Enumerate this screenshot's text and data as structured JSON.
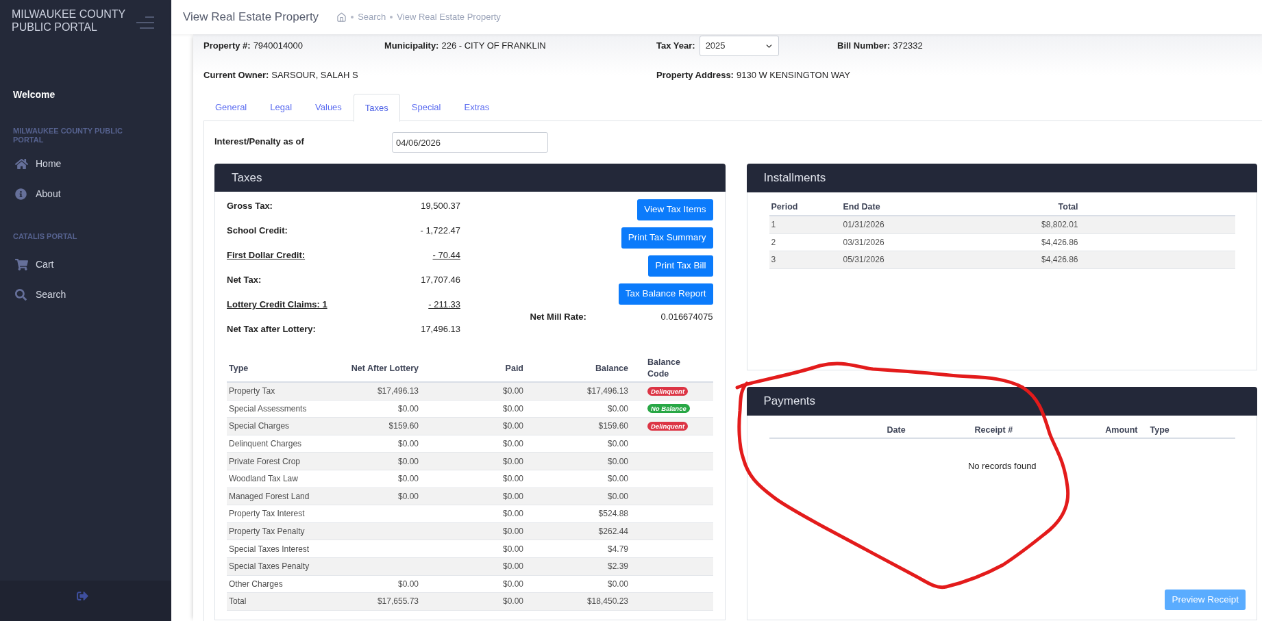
{
  "sidebar": {
    "title": "MILWAUKEE COUNTY PUBLIC PORTAL",
    "welcome": "Welcome",
    "sections": [
      {
        "heading": "MILWAUKEE COUNTY PUBLIC PORTAL",
        "items": [
          {
            "label": "Home",
            "kind": "home"
          },
          {
            "label": "About",
            "kind": "info"
          }
        ]
      },
      {
        "heading": "CATALIS PORTAL",
        "items": [
          {
            "label": "Cart",
            "kind": "cart"
          },
          {
            "label": "Search",
            "kind": "search"
          }
        ]
      }
    ]
  },
  "header": {
    "title": "View Real Estate Property",
    "breadcrumbs": [
      "Search",
      "View Real Estate Property"
    ]
  },
  "property_fields": [
    {
      "label": "Property #:",
      "value": "7940014000",
      "kind": "text"
    },
    {
      "label": "Municipality:",
      "value": "226 - CITY OF FRANKLIN",
      "kind": "text"
    },
    {
      "label": "Tax Year:",
      "value": "2025",
      "kind": "select"
    },
    {
      "label": "Bill Number:",
      "value": "372332",
      "kind": "text"
    },
    {
      "label": "Current Owner:",
      "value": "SARSOUR, SALAH S",
      "kind": "text"
    },
    {
      "label": "Property Address:",
      "value": "9130 W KENSINGTON WAY",
      "kind": "text"
    }
  ],
  "tabs": [
    {
      "label": "General",
      "selected": false
    },
    {
      "label": "Legal",
      "selected": false
    },
    {
      "label": "Values",
      "selected": false
    },
    {
      "label": "Taxes",
      "selected": true
    },
    {
      "label": "Special",
      "selected": false
    },
    {
      "label": "Extras",
      "selected": false
    }
  ],
  "interest_penalty": {
    "label": "Interest/Penalty as of",
    "value": "04/06/2026"
  },
  "taxes": {
    "title": "Taxes",
    "summary": [
      {
        "label": "Gross Tax:",
        "value": "19,500.37",
        "link": false
      },
      {
        "label": "School Credit:",
        "value": "- 1,722.47",
        "link": false
      },
      {
        "label": "First Dollar Credit:",
        "value": "- 70.44",
        "link": true
      },
      {
        "label": "Net Tax:",
        "value": "17,707.46",
        "link": false
      },
      {
        "label": "Lottery Credit Claims: 1",
        "value": "- 211.33",
        "link": true
      },
      {
        "label": "Net Tax after Lottery:",
        "value": "17,496.13",
        "link": false
      }
    ],
    "buttons": [
      "View Tax Items",
      "Print Tax Summary",
      "Print Tax Bill",
      "Tax Balance Report"
    ],
    "net_mill_rate": {
      "label": "Net Mill Rate:",
      "value": "0.016674075"
    },
    "table": {
      "columns": [
        "Type",
        "Net After Lottery",
        "Paid",
        "Balance",
        "Balance Code"
      ],
      "rows": [
        {
          "type": "Property Tax",
          "net_after_lottery": "$17,496.13",
          "paid": "$0.00",
          "balance": "$17,496.13",
          "badge": {
            "label": "Delinquent",
            "color": "#dc3545"
          }
        },
        {
          "type": "Special Assessments",
          "net_after_lottery": "$0.00",
          "paid": "$0.00",
          "balance": "$0.00",
          "badge": {
            "label": "No Balance",
            "color": "#28a745"
          }
        },
        {
          "type": "Special Charges",
          "net_after_lottery": "$159.60",
          "paid": "$0.00",
          "balance": "$159.60",
          "badge": {
            "label": "Delinquent",
            "color": "#dc3545"
          }
        },
        {
          "type": "Delinquent Charges",
          "net_after_lottery": "$0.00",
          "paid": "$0.00",
          "balance": "$0.00"
        },
        {
          "type": "Private Forest Crop",
          "net_after_lottery": "$0.00",
          "paid": "$0.00",
          "balance": "$0.00"
        },
        {
          "type": "Woodland Tax Law",
          "net_after_lottery": "$0.00",
          "paid": "$0.00",
          "balance": "$0.00"
        },
        {
          "type": "Managed Forest Land",
          "net_after_lottery": "$0.00",
          "paid": "$0.00",
          "balance": "$0.00"
        },
        {
          "type": "Property Tax Interest",
          "paid": "$0.00",
          "balance": "$524.88"
        },
        {
          "type": "Property Tax Penalty",
          "paid": "$0.00",
          "balance": "$262.44"
        },
        {
          "type": "Special Taxes Interest",
          "paid": "$0.00",
          "balance": "$4.79"
        },
        {
          "type": "Special Taxes Penalty",
          "paid": "$0.00",
          "balance": "$2.39"
        },
        {
          "type": "Other Charges",
          "net_after_lottery": "$0.00",
          "paid": "$0.00",
          "balance": "$0.00"
        },
        {
          "type": "Total",
          "net_after_lottery": "$17,655.73",
          "paid": "$0.00",
          "balance": "$18,450.23"
        }
      ]
    }
  },
  "installments": {
    "title": "Installments",
    "columns": [
      "Period",
      "End Date",
      "Total"
    ],
    "rows": [
      [
        "1",
        "01/31/2026",
        "$8,802.01"
      ],
      [
        "2",
        "03/31/2026",
        "$4,426.86"
      ],
      [
        "3",
        "05/31/2026",
        "$4,426.86"
      ]
    ]
  },
  "payments": {
    "title": "Payments",
    "columns": [
      "Date",
      "Receipt #",
      "Amount",
      "Type"
    ],
    "empty_message": "No records found",
    "button": {
      "label": "Preview Receipt",
      "disabled": true
    }
  },
  "markup": [
    {
      "kind": "freehand_loop"
    }
  ]
}
